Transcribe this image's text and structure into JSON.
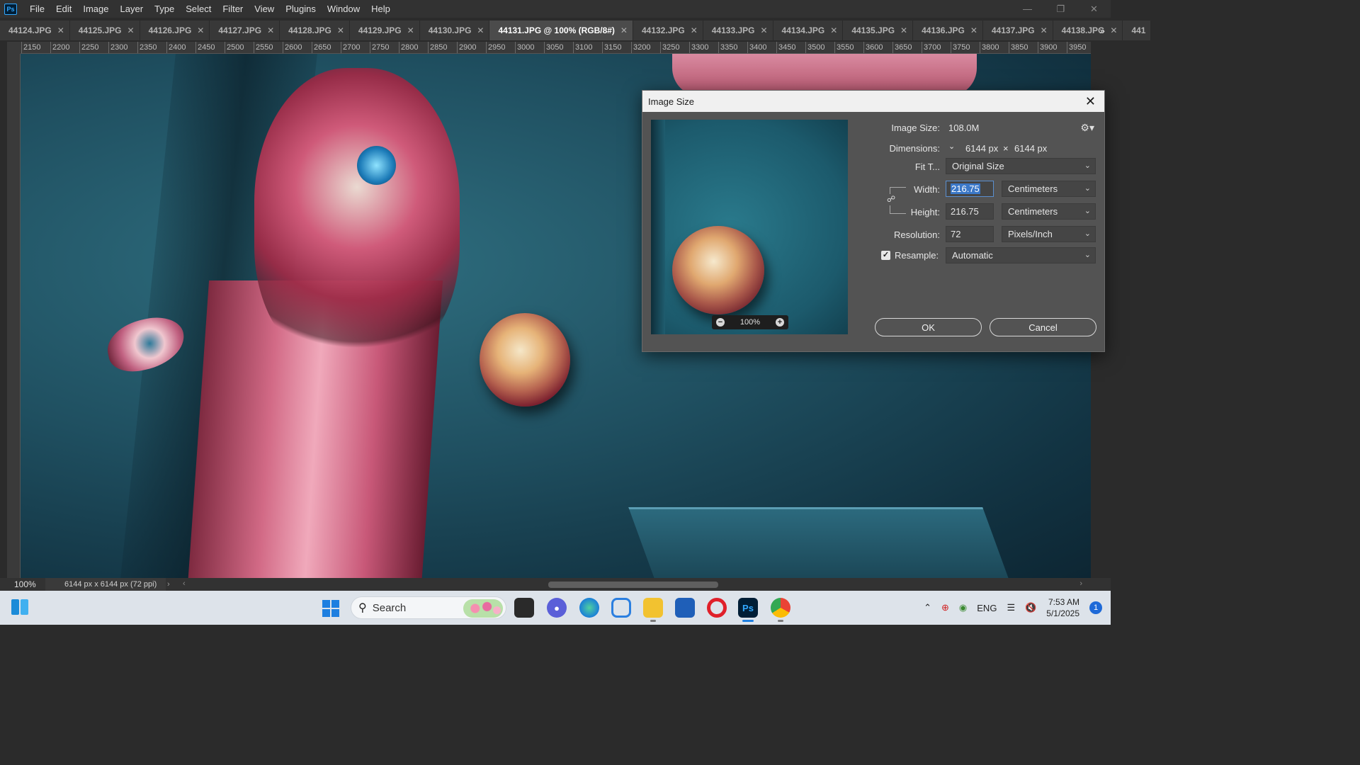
{
  "app": {
    "logo": "Ps",
    "menu": [
      "File",
      "Edit",
      "Image",
      "Layer",
      "Type",
      "Select",
      "Filter",
      "View",
      "Plugins",
      "Window",
      "Help"
    ]
  },
  "tabs": [
    {
      "label": "44124.JPG",
      "active": false
    },
    {
      "label": "44125.JPG",
      "active": false
    },
    {
      "label": "44126.JPG",
      "active": false
    },
    {
      "label": "44127.JPG",
      "active": false
    },
    {
      "label": "44128.JPG",
      "active": false
    },
    {
      "label": "44129.JPG",
      "active": false
    },
    {
      "label": "44130.JPG",
      "active": false
    },
    {
      "label": "44131.JPG @ 100% (RGB/8#)",
      "active": true
    },
    {
      "label": "44132.JPG",
      "active": false
    },
    {
      "label": "44133.JPG",
      "active": false
    },
    {
      "label": "44134.JPG",
      "active": false
    },
    {
      "label": "44135.JPG",
      "active": false
    },
    {
      "label": "44136.JPG",
      "active": false
    },
    {
      "label": "44137.JPG",
      "active": false
    },
    {
      "label": "44138.JPG",
      "active": false
    },
    {
      "label": "441",
      "active": false
    }
  ],
  "ruler": {
    "h_ticks": [
      "2150",
      "2200",
      "2250",
      "2300",
      "2350",
      "2400",
      "2450",
      "2500",
      "2550",
      "2600",
      "2650",
      "2700",
      "2750",
      "2800",
      "2850",
      "2900",
      "2950",
      "3000",
      "3050",
      "3100",
      "3150",
      "3200",
      "3250",
      "3300",
      "3350",
      "3400",
      "3450",
      "3500",
      "3550",
      "3600",
      "3650",
      "3700",
      "3750",
      "3800",
      "3850",
      "3900",
      "3950"
    ]
  },
  "status": {
    "zoom": "100%",
    "doc_info": "6144 px x 6144 px (72 ppi)"
  },
  "dialog": {
    "title": "Image Size",
    "image_size_label": "Image Size:",
    "image_size_value": "108.0M",
    "dimensions_label": "Dimensions:",
    "dim_width": "6144 px",
    "dim_x": "×",
    "dim_height": "6144 px",
    "fit_to_label": "Fit T...",
    "fit_to_value": "Original Size",
    "width_label": "Width:",
    "width_value": "216.75",
    "width_unit": "Centimeters",
    "height_label": "Height:",
    "height_value": "216.75",
    "height_unit": "Centimeters",
    "resolution_label": "Resolution:",
    "resolution_value": "72",
    "resolution_unit": "Pixels/Inch",
    "resample_label": "Resample:",
    "resample_checked": true,
    "resample_value": "Automatic",
    "preview_zoom": "100%",
    "ok_label": "OK",
    "cancel_label": "Cancel"
  },
  "taskbar": {
    "search_text": "Search",
    "tray_lang": "ENG",
    "time": "7:53 AM",
    "date": "5/1/2025",
    "notification_count": "1"
  }
}
